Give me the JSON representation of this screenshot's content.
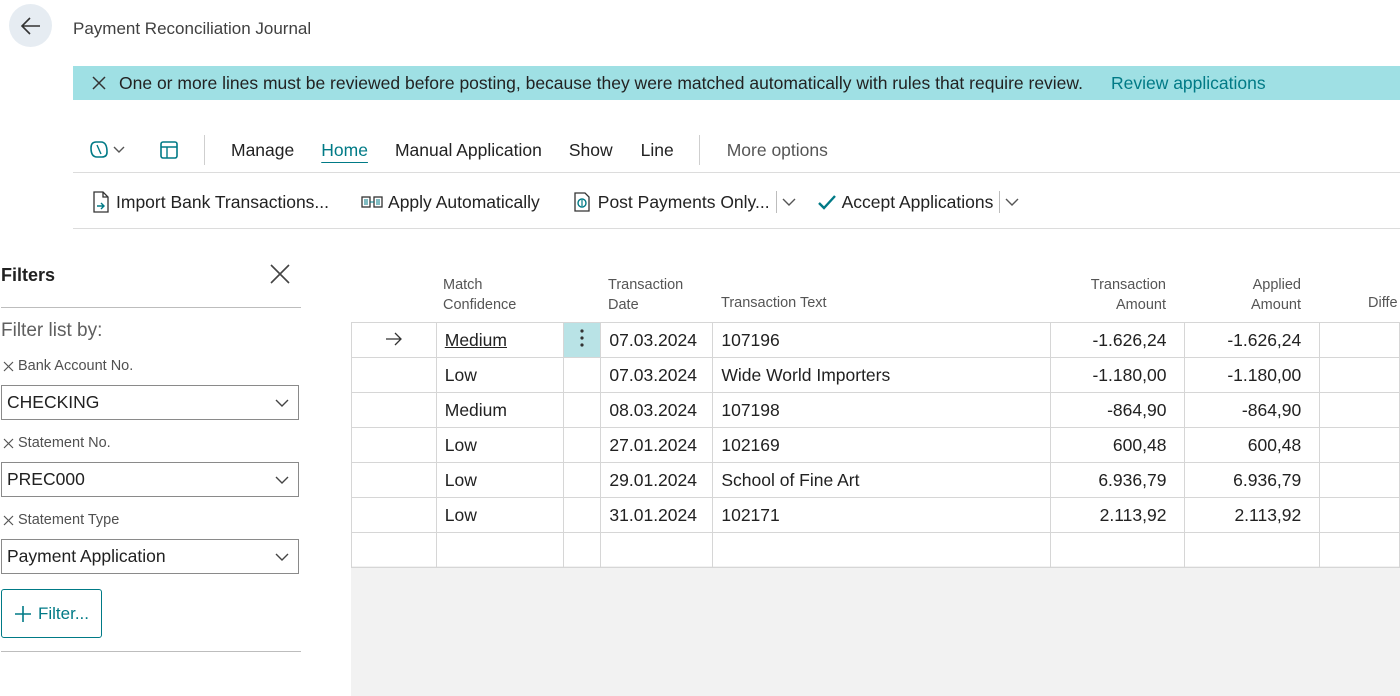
{
  "header": {
    "title": "Payment Reconciliation Journal"
  },
  "banner": {
    "message": "One or more lines must be reviewed before posting, because they were matched automatically with rules that require review.",
    "link": "Review applications"
  },
  "menu": {
    "items": [
      "Manage",
      "Home",
      "Manual Application",
      "Show",
      "Line"
    ],
    "active": "Home",
    "more": "More options"
  },
  "commands": {
    "import": "Import Bank Transactions...",
    "apply": "Apply Automatically",
    "post": "Post Payments Only...",
    "accept": "Accept Applications"
  },
  "filters": {
    "title": "Filters",
    "by": "Filter list by:",
    "fields": [
      {
        "label": "Bank Account No.",
        "value": "CHECKING"
      },
      {
        "label": "Statement No.",
        "value": "PREC000"
      },
      {
        "label": "Statement Type",
        "value": "Payment Application"
      }
    ],
    "add": "Filter..."
  },
  "grid": {
    "columns": {
      "match": [
        "Match",
        "Confidence"
      ],
      "date": [
        "Transaction",
        "Date"
      ],
      "text": "Transaction Text",
      "amount": [
        "Transaction",
        "Amount"
      ],
      "applied": [
        "Applied",
        "Amount"
      ],
      "diff": "Diffe"
    },
    "rows": [
      {
        "match": "Medium",
        "date": "07.03.2024",
        "text": "107196",
        "amount": "-1.626,24",
        "applied": "-1.626,24"
      },
      {
        "match": "Low",
        "date": "07.03.2024",
        "text": "Wide World Importers",
        "amount": "-1.180,00",
        "applied": "-1.180,00"
      },
      {
        "match": "Medium",
        "date": "08.03.2024",
        "text": "107198",
        "amount": "-864,90",
        "applied": "-864,90"
      },
      {
        "match": "Low",
        "date": "27.01.2024",
        "text": "102169",
        "amount": "600,48",
        "applied": "600,48"
      },
      {
        "match": "Low",
        "date": "29.01.2024",
        "text": "School of Fine Art",
        "amount": "6.936,79",
        "applied": "6.936,79"
      },
      {
        "match": "Low",
        "date": "31.01.2024",
        "text": "102171",
        "amount": "2.113,92",
        "applied": "2.113,92"
      }
    ]
  },
  "colors": {
    "accent": "#007a86",
    "banner": "#9fe0e4",
    "selected_cell": "#b9e3e6"
  }
}
